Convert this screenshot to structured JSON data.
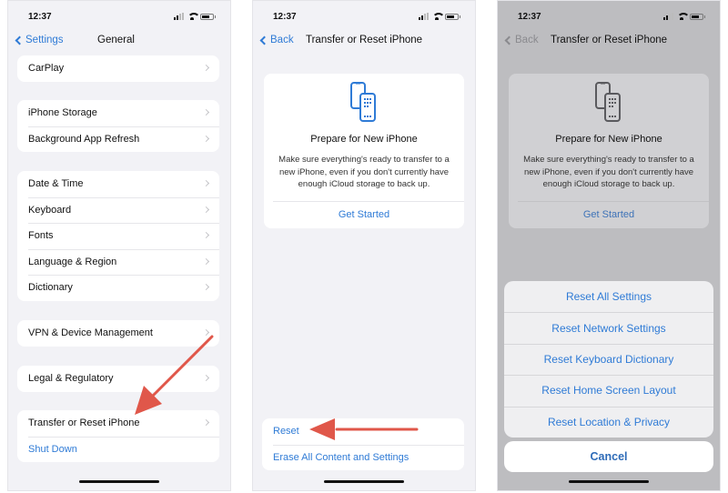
{
  "panels": [
    {
      "status": {
        "time": "12:37"
      },
      "nav": {
        "back_label": "Settings",
        "title": "General"
      },
      "groups": [
        {
          "items": [
            {
              "label": "CarPlay",
              "chevron": true
            }
          ]
        },
        {
          "items": [
            {
              "label": "iPhone Storage",
              "chevron": true
            },
            {
              "label": "Background App Refresh",
              "chevron": true
            }
          ]
        },
        {
          "items": [
            {
              "label": "Date & Time",
              "chevron": true
            },
            {
              "label": "Keyboard",
              "chevron": true
            },
            {
              "label": "Fonts",
              "chevron": true
            },
            {
              "label": "Language & Region",
              "chevron": true
            },
            {
              "label": "Dictionary",
              "chevron": true
            }
          ]
        },
        {
          "items": [
            {
              "label": "VPN & Device Management",
              "chevron": true
            }
          ]
        },
        {
          "items": [
            {
              "label": "Legal & Regulatory",
              "chevron": true
            }
          ]
        },
        {
          "items": [
            {
              "label": "Transfer or Reset iPhone",
              "chevron": true
            },
            {
              "label": "Shut Down",
              "chevron": false
            }
          ]
        }
      ],
      "annotation": "arrow pointing to Transfer or Reset iPhone"
    },
    {
      "status": {
        "time": "12:37"
      },
      "nav": {
        "back_label": "Back",
        "title": "Transfer or Reset iPhone"
      },
      "card": {
        "icon": "phone-transfer-icon",
        "title": "Prepare for New iPhone",
        "description": "Make sure everything's ready to transfer to a new iPhone, even if you don't currently have enough iCloud storage to back up.",
        "link": "Get Started"
      },
      "actions": [
        "Reset",
        "Erase All Content and Settings"
      ],
      "annotation": "arrow pointing to Reset"
    },
    {
      "status": {
        "time": "12:37"
      },
      "nav": {
        "back_label": "Back",
        "title": "Transfer or Reset iPhone"
      },
      "card": {
        "icon": "phone-transfer-icon",
        "title": "Prepare for New iPhone",
        "description": "Make sure everything's ready to transfer to a new iPhone, even if you don't currently have enough iCloud storage to back up.",
        "link": "Get Started"
      },
      "sheet": {
        "options": [
          "Reset All Settings",
          "Reset Network Settings",
          "Reset Keyboard Dictionary",
          "Reset Home Screen Layout",
          "Reset Location & Privacy"
        ],
        "cancel": "Cancel"
      }
    }
  ],
  "colors": {
    "accent": "#2f7bd6",
    "annotation_arrow": "#e0574a",
    "background": "#f2f2f6"
  }
}
